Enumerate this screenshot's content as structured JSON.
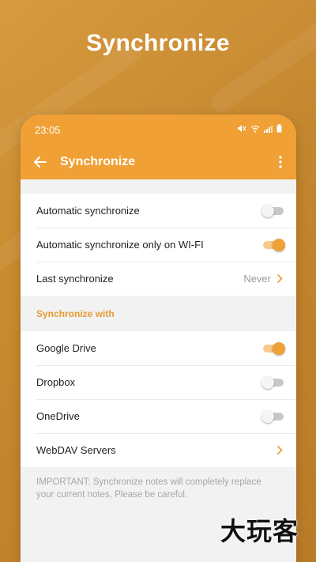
{
  "headline": "Synchronize",
  "status_bar": {
    "time": "23:05"
  },
  "app_bar": {
    "title": "Synchronize"
  },
  "settings": [
    {
      "label": "Automatic synchronize",
      "toggle": false
    },
    {
      "label": "Automatic synchronize only on WI-FI",
      "toggle": true
    },
    {
      "label": "Last synchronize",
      "value": "Never"
    }
  ],
  "sync_section": {
    "header": "Synchronize with",
    "items": [
      {
        "label": "Google Drive",
        "toggle": true
      },
      {
        "label": "Dropbox",
        "toggle": false
      },
      {
        "label": "OneDrive",
        "toggle": false
      },
      {
        "label": "WebDAV Servers"
      }
    ]
  },
  "note": "IMPORTANT: Synchronize notes will completely replace your current notes, Please be careful.",
  "watermark": "大玩客",
  "colors": {
    "accent": "#f0a035",
    "background": "#c98a2e"
  },
  "icons": [
    "back-arrow-icon",
    "more-vert-icon",
    "chevron-right-icon",
    "mute-icon",
    "wifi-icon",
    "signal-icon",
    "battery-icon"
  ]
}
